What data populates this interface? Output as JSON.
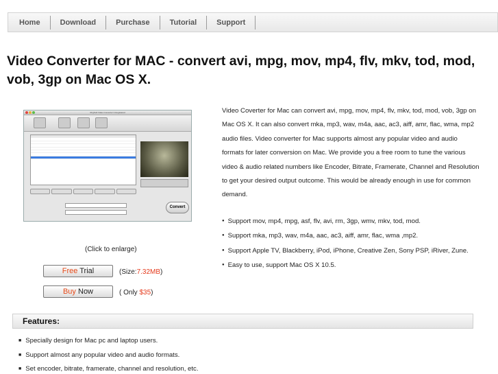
{
  "nav": {
    "items": [
      "Home",
      "Download",
      "Purchase",
      "Tutorial",
      "Support"
    ]
  },
  "headline": "Video Converter for MAC - convert avi, mpg, mov, mp4, flv, mkv, tod, mod, vob, 3gp on Mac OS X.",
  "screenshot": {
    "window_title": "iOrgSoft Video Converter Unregistered",
    "convert_label": "Convert",
    "enlarge_caption": "(Click to enlarge)"
  },
  "trial": {
    "accent": "Free",
    "word": "Trial",
    "note_prefix": "(Size:",
    "size": "7.32MB",
    "note_suffix": ")"
  },
  "buy": {
    "accent": "Buy",
    "word": "Now",
    "note_prefix": "( Only ",
    "price": "$35",
    "note_suffix": ")"
  },
  "description": "Video Coverter for Mac can convert avi, mpg, mov, mp4, flv, mkv, tod, mod, vob, 3gp on Mac OS X. It can also convert mka, mp3, wav, m4a, aac, ac3, aiff, amr, flac, wma, mp2 audio files. Video converter for Mac supports almost any popular video and audio formats for later conversion on Mac. We provide you a free room to tune the various video & audio related numbers like Encoder, Bitrate, Framerate, Channel and Resolution to get your desired output outcome. This would be already enough in use for common demand.",
  "bullets": [
    "Support mov, mp4, mpg, asf, flv, avi, rm, 3gp, wmv, mkv, tod, mod.",
    "Support mka, mp3, wav, m4a, aac, ac3, aiff, amr, flac, wma ,mp2.",
    "Support Apple TV, Blackberry, iPod, iPhone, Creative Zen, Sony PSP, iRiver, Zune.",
    "Easy to use, support Mac OS X 10.5."
  ],
  "features": {
    "title": "Features:",
    "items": [
      "Specially design for Mac pc and laptop users.",
      "Support almost any popular video and audio formats.",
      "Set encoder, bitrate, framerate, channel and resolution, etc."
    ]
  },
  "colors": {
    "accent_orange": "#e64a19",
    "price_red": "#e53a1c",
    "selection_blue": "#3a7be0"
  }
}
